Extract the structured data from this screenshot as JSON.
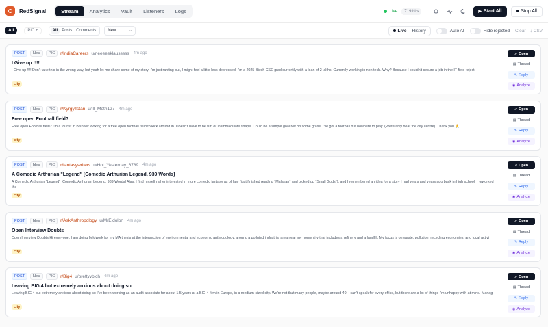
{
  "app": {
    "name": "RedSignal"
  },
  "nav": {
    "tabs": [
      "Stream",
      "Analytics",
      "Vault",
      "Listeners",
      "Logs"
    ],
    "active": 0
  },
  "status": {
    "live_label": "Live",
    "hits_label": "719 hits"
  },
  "controls": {
    "start_label": "Start All",
    "stop_label": "Stop All"
  },
  "filters": {
    "all_label": "All",
    "pic_label": "PIC",
    "type_tabs": [
      "All",
      "Posts",
      "Comments"
    ],
    "sort_value": "New",
    "mode_tabs": [
      "Live",
      "History"
    ],
    "auto_ai_label": "Auto AI",
    "hide_rejected_label": "Hide rejected",
    "clear_label": "Clear",
    "csv_label": "CSV"
  },
  "action_labels": {
    "open": "Open",
    "thread": "Thread",
    "reply": "Reply",
    "analyze": "Analyze"
  },
  "posts": [
    {
      "type": "POST",
      "state": "New",
      "tag": "PIC",
      "subreddit": "r/IndiaCareers",
      "user": "u/neeeeeklausssss",
      "ago": "4m ago",
      "title": "I Give up !!!!",
      "body": "I Give up !!!! Don't take this in the wrong way, but yeah let me share some of my story. I'm just ranting out, I might feel a little less depressed. I'm a 2025 Btech CSE grad currently with a loan of 2 lakhs. Currently working in non tech. Why? Because I couldn't secure a job in the IT field reject",
      "keyword": "city"
    },
    {
      "type": "POST",
      "state": "New",
      "tag": "PIC",
      "subreddit": "r/Kyrgyzstan",
      "user": "u/Ill_Moth127",
      "ago": "4m ago",
      "title": "Free open Football field?",
      "body": "Free open Football field? I'm a tourist in Bishkek looking for a free open football field to kick around in. Doesn't have to be turf or in immaculate shape. Could be a simple goal net on some grass. I've got a football but nowhere to play. (Preferably near the city centre). Thank you 🙏",
      "keyword": "city"
    },
    {
      "type": "POST",
      "state": "New",
      "tag": "PIC",
      "subreddit": "r/fantasywriters",
      "user": "u/Hot_Yesterday_6789",
      "ago": "4m ago",
      "title": "A Comedic Arthurian \"Legend\" [Comedic Arthurian Legend, 939 Words]",
      "body": "A Comedic Arthurian \"Legend\" [Comedic Arthurian Legend, 939 Words] Alas, I find myself rather interested in more comedic fantasy as of late (just finished reading *Malazan* and picked up *Small Gods*), and I remembered an idea for a story I had years and years ago back in high school. I reworked the",
      "keyword": "city"
    },
    {
      "type": "POST",
      "state": "New",
      "tag": "PIC",
      "subreddit": "r/AskAnthropology",
      "user": "u/MrEidolon",
      "ago": "4m ago",
      "title": "Open Interview Doubts",
      "body": "Open Interview Doubts Hi everyone, I am doing fieldwork for my MA thesis at the intersection of environmental and economic anthropology, around a polluted industrial area near my home city that includes a refinery and a landfill. My focus is on waste, pollution, recycling economies, and local activi",
      "keyword": "city"
    },
    {
      "type": "POST",
      "state": "New",
      "tag": "PIC",
      "subreddit": "r/Big4",
      "user": "u/prettyvbich",
      "ago": "4m ago",
      "title": "Leaving BIG 4 but extremely anxious about doing so",
      "body": "Leaving BIG 4 but extremely anxious about doing so I've been working as an audit associate for about 1.5 years at a BIG 4 firm in Europe, in a medium-sized city. We're not that many people, maybe around 40. I can't speak for every office, but there are a lot of things I'm unhappy with at mine. Manag",
      "keyword": "city"
    }
  ]
}
